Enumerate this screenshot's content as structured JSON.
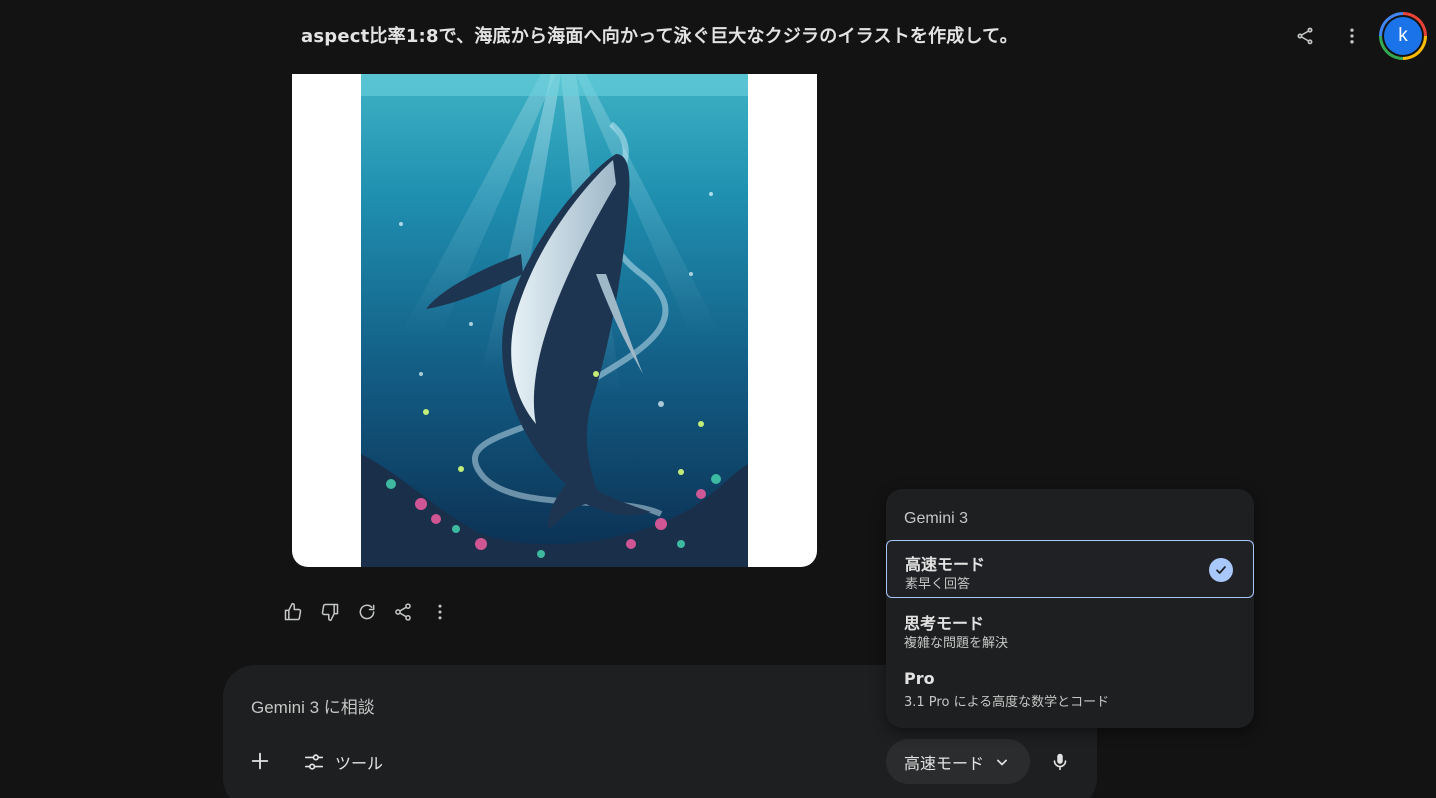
{
  "header": {
    "title": "aspect比率1:8で、海底から海面へ向かって泳ぐ巨大なクジラのイラストを作成して。",
    "share_icon": "share-icon",
    "more_icon": "more-vert-icon",
    "avatar_initial": "k"
  },
  "response": {
    "image_description_icon": "whale-illustration",
    "actions": [
      {
        "name": "thumb-up-icon"
      },
      {
        "name": "thumb-down-icon"
      },
      {
        "name": "regenerate-icon"
      },
      {
        "name": "share-icon"
      },
      {
        "name": "more-vert-icon"
      }
    ]
  },
  "composer": {
    "placeholder": "Gemini 3 に相談",
    "plus_icon": "plus-icon",
    "tools_label": "ツール",
    "mode_label": "高速モード",
    "mic_icon": "mic-icon"
  },
  "mode_menu": {
    "heading": "Gemini 3",
    "items": [
      {
        "title": "高速モード",
        "subtitle": "素早く回答",
        "selected": true
      },
      {
        "title": "思考モード",
        "subtitle": "複雑な問題を解決",
        "selected": false
      },
      {
        "title": "Pro",
        "subtitle": "3.1 Pro による高度な数学とコード",
        "selected": false
      }
    ]
  },
  "colors": {
    "background": "#131314",
    "surface": "#1e1f20",
    "accent": "#a8c7fa",
    "avatar": "#1a73e8"
  }
}
